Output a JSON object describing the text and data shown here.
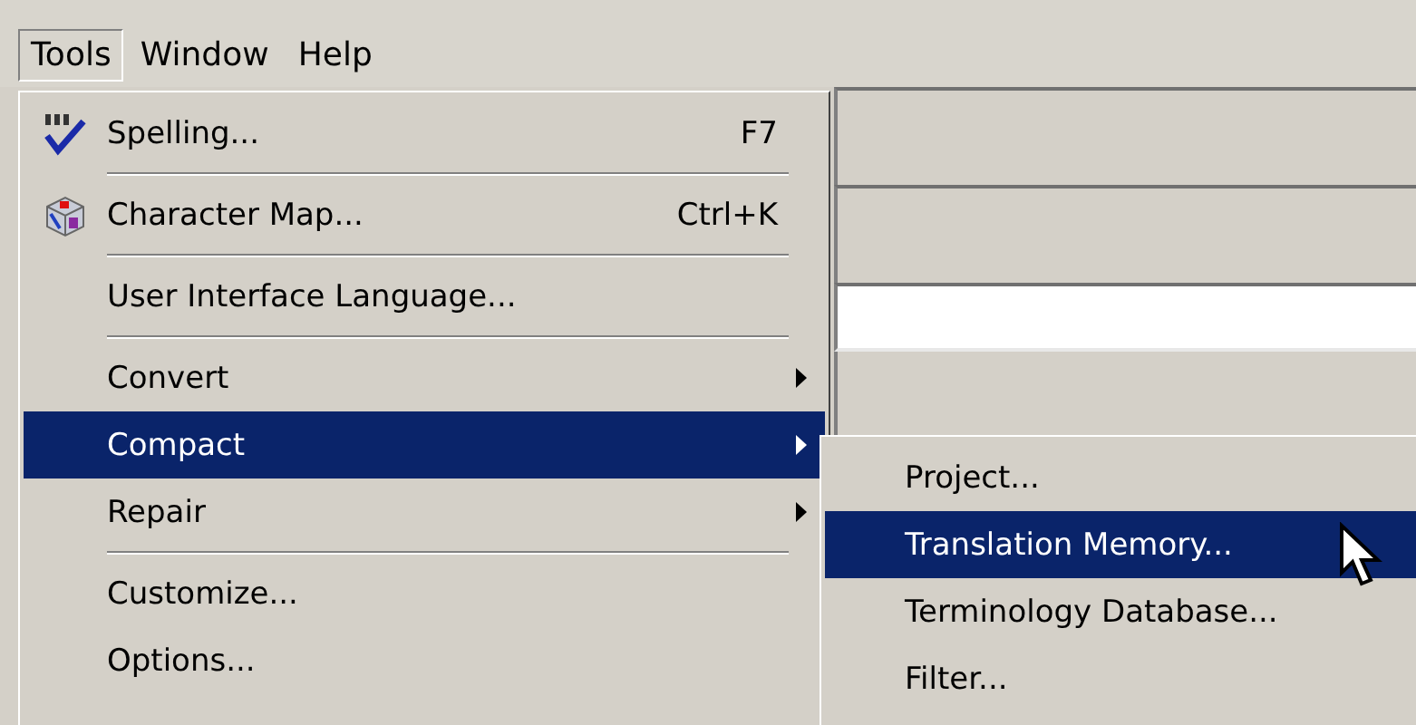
{
  "menubar": [
    {
      "label": "Tools",
      "selected": true
    },
    {
      "label": "Window",
      "selected": false
    },
    {
      "label": "Help",
      "selected": false
    }
  ],
  "menu": {
    "items": [
      {
        "kind": "command",
        "label": "Spelling...",
        "shortcut": "F7",
        "icon": true,
        "selected": false
      },
      {
        "kind": "separator"
      },
      {
        "kind": "command",
        "label": "Character Map...",
        "shortcut": "Ctrl+K",
        "icon": true,
        "selected": false
      },
      {
        "kind": "separator"
      },
      {
        "kind": "command",
        "label": "User Interface Language...",
        "selected": false
      },
      {
        "kind": "separator"
      },
      {
        "kind": "submenu",
        "label": "Convert",
        "selected": false
      },
      {
        "kind": "submenu",
        "label": "Compact",
        "selected": true
      },
      {
        "kind": "submenu",
        "label": "Repair",
        "selected": false
      },
      {
        "kind": "separator"
      },
      {
        "kind": "command",
        "label": "Customize...",
        "selected": false
      },
      {
        "kind": "command",
        "label": "Options...",
        "selected": false
      }
    ]
  },
  "submenu": {
    "items": [
      {
        "label": "Project...",
        "selected": false
      },
      {
        "label": "Translation Memory...",
        "selected": true
      },
      {
        "label": "Terminology Database...",
        "selected": false
      },
      {
        "label": "Filter...",
        "selected": false
      }
    ]
  }
}
